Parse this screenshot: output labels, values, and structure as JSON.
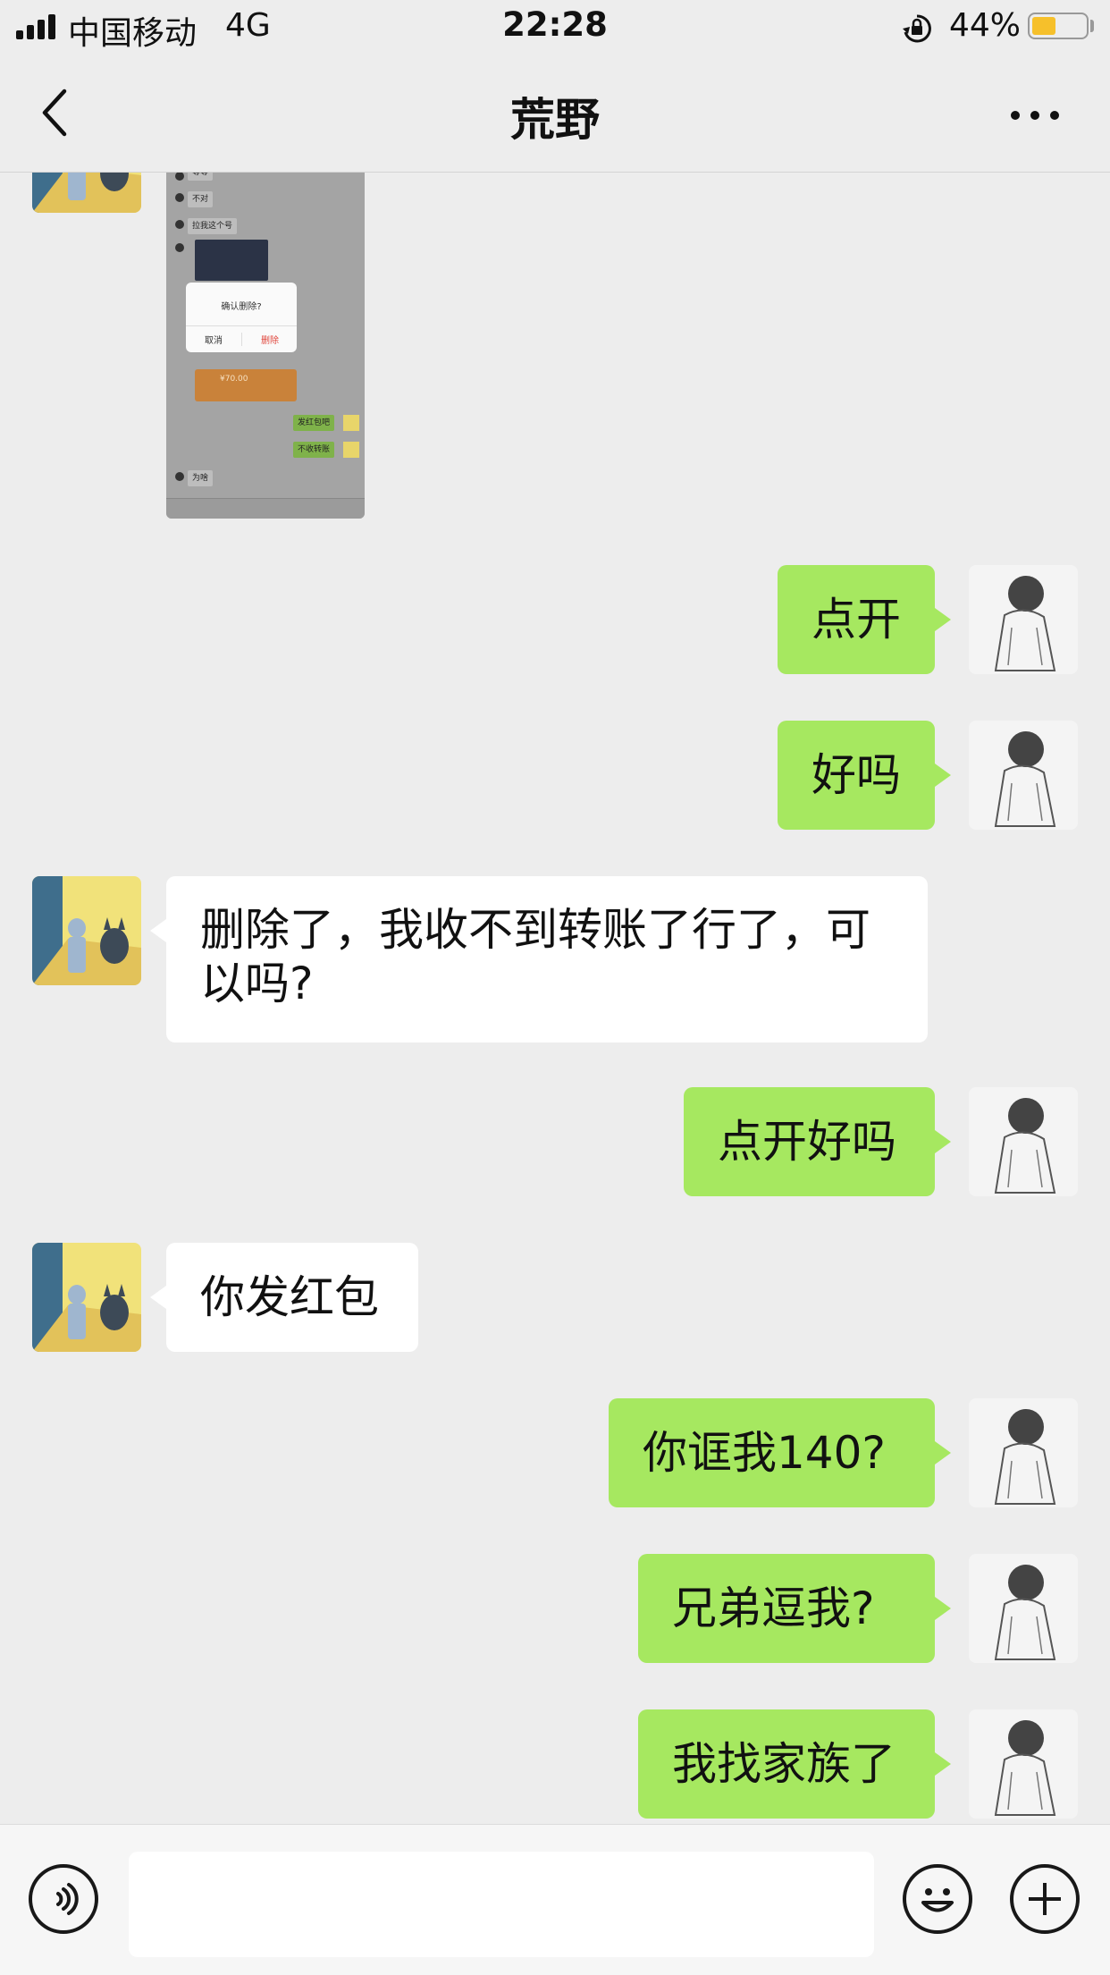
{
  "status_bar": {
    "carrier": "中国移动",
    "network": "4G",
    "time": "22:28",
    "battery_percent": "44%",
    "battery_level": 0.44
  },
  "nav": {
    "title": "荒野",
    "back_icon": "chevron-left-icon",
    "more_icon": "ellipsis-icon"
  },
  "screenshot_preview": {
    "lines": [
      "等等",
      "不对",
      "拉我这个号"
    ],
    "dialog_title": "确认删除?",
    "dialog_cancel": "取消",
    "dialog_confirm": "删除",
    "red_packet_amount": "¥70.00",
    "outgoing_lines": [
      "发红包吧",
      "不收转账"
    ],
    "last_line": "为啥"
  },
  "messages": [
    {
      "id": "m1",
      "sender": "me",
      "text": "点开"
    },
    {
      "id": "m2",
      "sender": "me",
      "text": "好吗"
    },
    {
      "id": "m3",
      "sender": "other",
      "line1": "删除了，我收不到转账了行了，可",
      "line2": "以吗?"
    },
    {
      "id": "m4",
      "sender": "me",
      "text": "点开好吗"
    },
    {
      "id": "m5",
      "sender": "other",
      "text": "你发红包"
    },
    {
      "id": "m6",
      "sender": "me",
      "text": "你诓我140?"
    },
    {
      "id": "m7",
      "sender": "me",
      "text": "兄弟逗我?"
    },
    {
      "id": "m8",
      "sender": "me",
      "text": "我找家族了"
    }
  ],
  "input_bar": {
    "voice_icon": "voice-icon",
    "emoji_icon": "emoji-icon",
    "plus_icon": "plus-icon",
    "placeholder": ""
  },
  "colors": {
    "background": "#ededed",
    "outgoing_bubble": "#a6e860",
    "incoming_bubble": "#ffffff",
    "battery": "#f6c02b"
  }
}
